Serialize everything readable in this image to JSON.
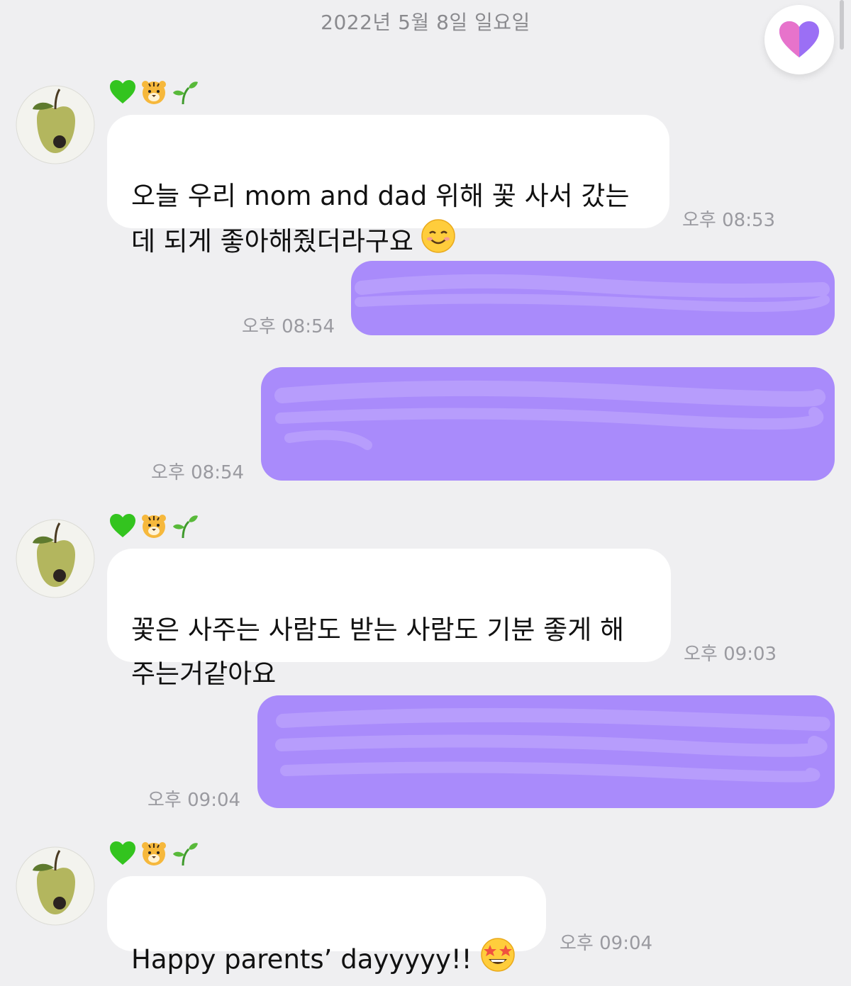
{
  "header": {
    "date": "2022년 5월 8일 일요일"
  },
  "colors": {
    "background": "#efeff1",
    "incoming_bubble": "#ffffff",
    "outgoing_bubble": "#a98bfb",
    "outgoing_redaction": "#b79dfc",
    "timestamp": "#9a9aa0"
  },
  "sender": {
    "avatar_icon": "apple-avatar-icon",
    "badges": [
      "green-heart-icon",
      "tiger-face-icon",
      "seedling-icon"
    ]
  },
  "messages": [
    {
      "direction": "incoming",
      "text": "오늘 우리 mom and dad 위해 꽃 사서 갔는\n데 되게 좋아해줬더라구요",
      "emoji": "smiling-face-icon",
      "time": "오후 08:53"
    },
    {
      "direction": "outgoing",
      "redacted": true,
      "time": "오후 08:54"
    },
    {
      "direction": "outgoing",
      "redacted": true,
      "time": "오후 08:54"
    },
    {
      "direction": "incoming",
      "text": "꽃은 사주는 사람도 받는 사람도 기분 좋게 해\n주는거같아요",
      "time": "오후 09:03"
    },
    {
      "direction": "outgoing",
      "redacted": true,
      "time": "오후 09:04"
    },
    {
      "direction": "incoming",
      "text": "Happy parents’ dayyyyy!!",
      "emoji": "star-struck-face-icon",
      "time": "오후 09:04"
    }
  ],
  "fab": {
    "icon": "heart-icon"
  }
}
